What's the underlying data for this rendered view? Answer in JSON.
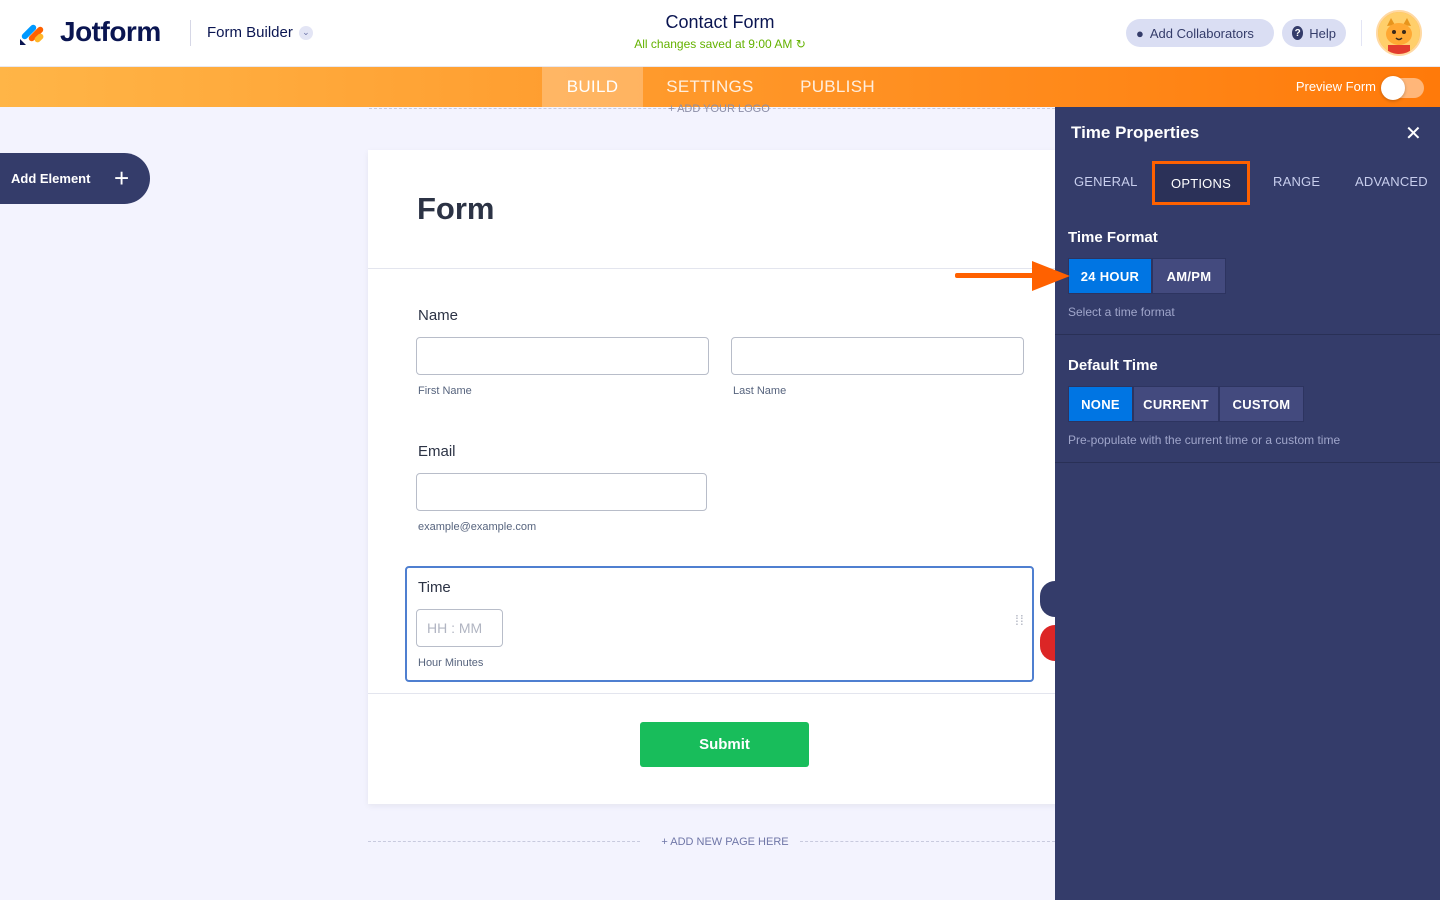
{
  "header": {
    "logo_text": "Jotform",
    "builder_label": "Form Builder",
    "form_title": "Contact Form",
    "saved_status": "All changes saved at 9:00 AM",
    "collaborators_label": "Add Collaborators",
    "help_label": "Help"
  },
  "nav": {
    "tabs": [
      {
        "label": "BUILD",
        "active": true
      },
      {
        "label": "SETTINGS",
        "active": false
      },
      {
        "label": "PUBLISH",
        "active": false
      }
    ],
    "preview_label": "Preview Form",
    "preview_on": false
  },
  "sidebar": {
    "add_element_label": "Add Element"
  },
  "canvas": {
    "add_logo": "+ ADD YOUR LOGO",
    "form_heading": "Form",
    "fields": {
      "name_label": "Name",
      "first_name_sub": "First Name",
      "last_name_sub": "Last Name",
      "email_label": "Email",
      "email_sub": "example@example.com",
      "time_label": "Time",
      "time_placeholder": "HH : MM",
      "time_sub": "Hour Minutes"
    },
    "submit_label": "Submit",
    "add_page": "+ ADD NEW PAGE HERE"
  },
  "panel": {
    "title": "Time Properties",
    "tabs": [
      {
        "label": "GENERAL"
      },
      {
        "label": "OPTIONS",
        "active": true
      },
      {
        "label": "RANGE"
      },
      {
        "label": "ADVANCED"
      }
    ],
    "time_format": {
      "title": "Time Format",
      "options": [
        "24 HOUR",
        "AM/PM"
      ],
      "selected": "24 HOUR",
      "hint": "Select a time format"
    },
    "default_time": {
      "title": "Default Time",
      "options": [
        "NONE",
        "CURRENT",
        "CUSTOM"
      ],
      "selected": "NONE",
      "hint": "Pre-populate with the current time or a custom time"
    }
  },
  "colors": {
    "accent_orange": "#ff6100",
    "selected_blue": "#0075e3",
    "panel_bg": "#343c6a",
    "submit_green": "#18bd5b"
  }
}
